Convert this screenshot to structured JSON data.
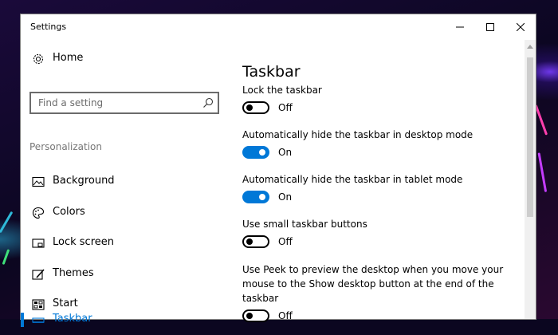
{
  "window": {
    "title": "Settings",
    "controls": {
      "minimize": "minimize-icon",
      "maximize": "maximize-icon",
      "close": "close-icon"
    }
  },
  "sidebar": {
    "home_label": "Home",
    "search": {
      "placeholder": "Find a setting",
      "value": ""
    },
    "section_label": "Personalization",
    "items": [
      {
        "label": "Background",
        "icon": "picture-icon"
      },
      {
        "label": "Colors",
        "icon": "palette-icon"
      },
      {
        "label": "Lock screen",
        "icon": "lock-screen-icon"
      },
      {
        "label": "Themes",
        "icon": "themes-icon"
      },
      {
        "label": "Start",
        "icon": "start-icon"
      },
      {
        "label": "Taskbar",
        "icon": "taskbar-icon",
        "active": true
      }
    ]
  },
  "main": {
    "title": "Taskbar",
    "settings": [
      {
        "label": "Lock the taskbar",
        "state": "Off",
        "on": false
      },
      {
        "label": "Automatically hide the taskbar in desktop mode",
        "state": "On",
        "on": true
      },
      {
        "label": "Automatically hide the taskbar in tablet mode",
        "state": "On",
        "on": true
      },
      {
        "label": "Use small taskbar buttons",
        "state": "Off",
        "on": false
      },
      {
        "label": "Use Peek to preview the desktop when you move your mouse to the Show desktop button at the end of the taskbar",
        "state": "Off",
        "on": false
      }
    ]
  },
  "colors": {
    "accent": "#0078d7",
    "text": "#000000",
    "muted": "#767676"
  }
}
